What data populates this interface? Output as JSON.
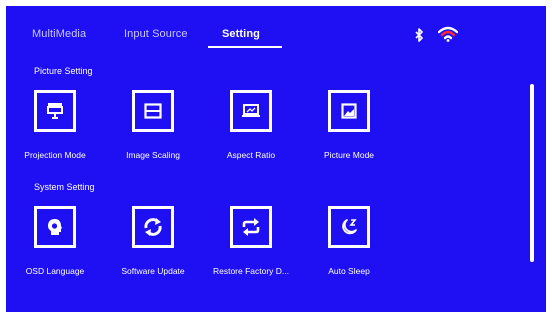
{
  "tabs": [
    {
      "label": "MultiMedia",
      "active": false
    },
    {
      "label": "Input Source",
      "active": false
    },
    {
      "label": "Setting",
      "active": true
    }
  ],
  "status": {
    "bluetooth_icon": "bluetooth-icon",
    "wifi_icon": "wifi-icon",
    "wifi_color": "#ff2a2a"
  },
  "sections": {
    "picture": {
      "label": "Picture Setting",
      "items": [
        {
          "label": "Projection Mode",
          "icon": "projector-icon"
        },
        {
          "label": "Image Scaling",
          "icon": "scaling-icon"
        },
        {
          "label": "Aspect Ratio",
          "icon": "aspect-ratio-icon"
        },
        {
          "label": "Picture Mode",
          "icon": "picture-mode-icon"
        }
      ]
    },
    "system": {
      "label": "System Setting",
      "items": [
        {
          "label": "OSD Language",
          "icon": "language-icon"
        },
        {
          "label": "Software Update",
          "icon": "update-icon"
        },
        {
          "label": "Restore Factory D...",
          "icon": "restore-icon"
        },
        {
          "label": "Auto Sleep",
          "icon": "sleep-icon"
        }
      ]
    }
  },
  "colors": {
    "background": "#1e10f2",
    "text": "#ffffff",
    "inactive_tab": "#c9c6ff"
  }
}
